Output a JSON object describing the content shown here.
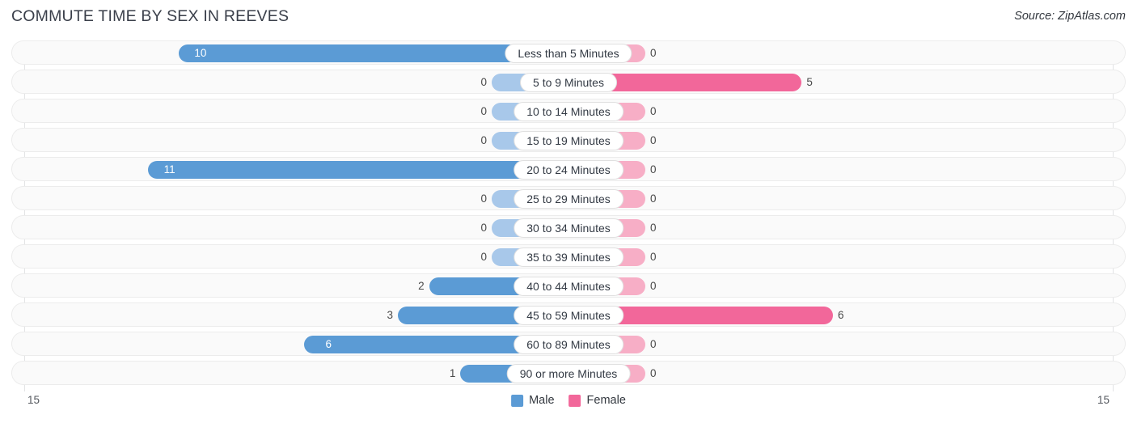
{
  "header": {
    "title": "COMMUTE TIME BY SEX IN REEVES",
    "source": "Source: ZipAtlas.com"
  },
  "axis": {
    "left_end": "15",
    "right_end": "15"
  },
  "legend": {
    "items": [
      {
        "label": "Male",
        "color": "#5b9bd5"
      },
      {
        "label": "Female",
        "color": "#f2679a"
      }
    ]
  },
  "colors": {
    "male_strong": "#5b9bd5",
    "male_light": "#a8c8ea",
    "female_strong": "#f2679a",
    "female_light": "#f7aec6",
    "row_track": "#fafafa",
    "row_border": "#ececec",
    "gridline": "#e2e3e5"
  },
  "chart_data": {
    "type": "bar",
    "title": "COMMUTE TIME BY SEX IN REEVES",
    "subtitle": "Source: ZipAtlas.com",
    "orientation": "horizontal",
    "layout": "diverging-bidirectional",
    "xlabel": "",
    "ylabel": "",
    "xlim": [
      15,
      15
    ],
    "axis_max_per_side": 15,
    "grid": false,
    "legend_position": "bottom-center",
    "categories": [
      "Less than 5 Minutes",
      "5 to 9 Minutes",
      "10 to 14 Minutes",
      "15 to 19 Minutes",
      "20 to 24 Minutes",
      "25 to 29 Minutes",
      "30 to 34 Minutes",
      "35 to 39 Minutes",
      "40 to 44 Minutes",
      "45 to 59 Minutes",
      "60 to 89 Minutes",
      "90 or more Minutes"
    ],
    "series": [
      {
        "name": "Male",
        "direction": "left",
        "values": [
          10,
          0,
          0,
          0,
          11,
          0,
          0,
          0,
          2,
          3,
          6,
          1
        ]
      },
      {
        "name": "Female",
        "direction": "right",
        "values": [
          0,
          5,
          0,
          0,
          0,
          0,
          0,
          0,
          0,
          6,
          0,
          0
        ]
      }
    ]
  },
  "rows": [
    {
      "label": "Less than 5 Minutes",
      "male": "10",
      "female": "0"
    },
    {
      "label": "5 to 9 Minutes",
      "male": "0",
      "female": "5"
    },
    {
      "label": "10 to 14 Minutes",
      "male": "0",
      "female": "0"
    },
    {
      "label": "15 to 19 Minutes",
      "male": "0",
      "female": "0"
    },
    {
      "label": "20 to 24 Minutes",
      "male": "11",
      "female": "0"
    },
    {
      "label": "25 to 29 Minutes",
      "male": "0",
      "female": "0"
    },
    {
      "label": "30 to 34 Minutes",
      "male": "0",
      "female": "0"
    },
    {
      "label": "35 to 39 Minutes",
      "male": "0",
      "female": "0"
    },
    {
      "label": "40 to 44 Minutes",
      "male": "2",
      "female": "0"
    },
    {
      "label": "45 to 59 Minutes",
      "male": "3",
      "female": "6"
    },
    {
      "label": "60 to 89 Minutes",
      "male": "6",
      "female": "0"
    },
    {
      "label": "90 or more Minutes",
      "male": "1",
      "female": "0"
    }
  ]
}
